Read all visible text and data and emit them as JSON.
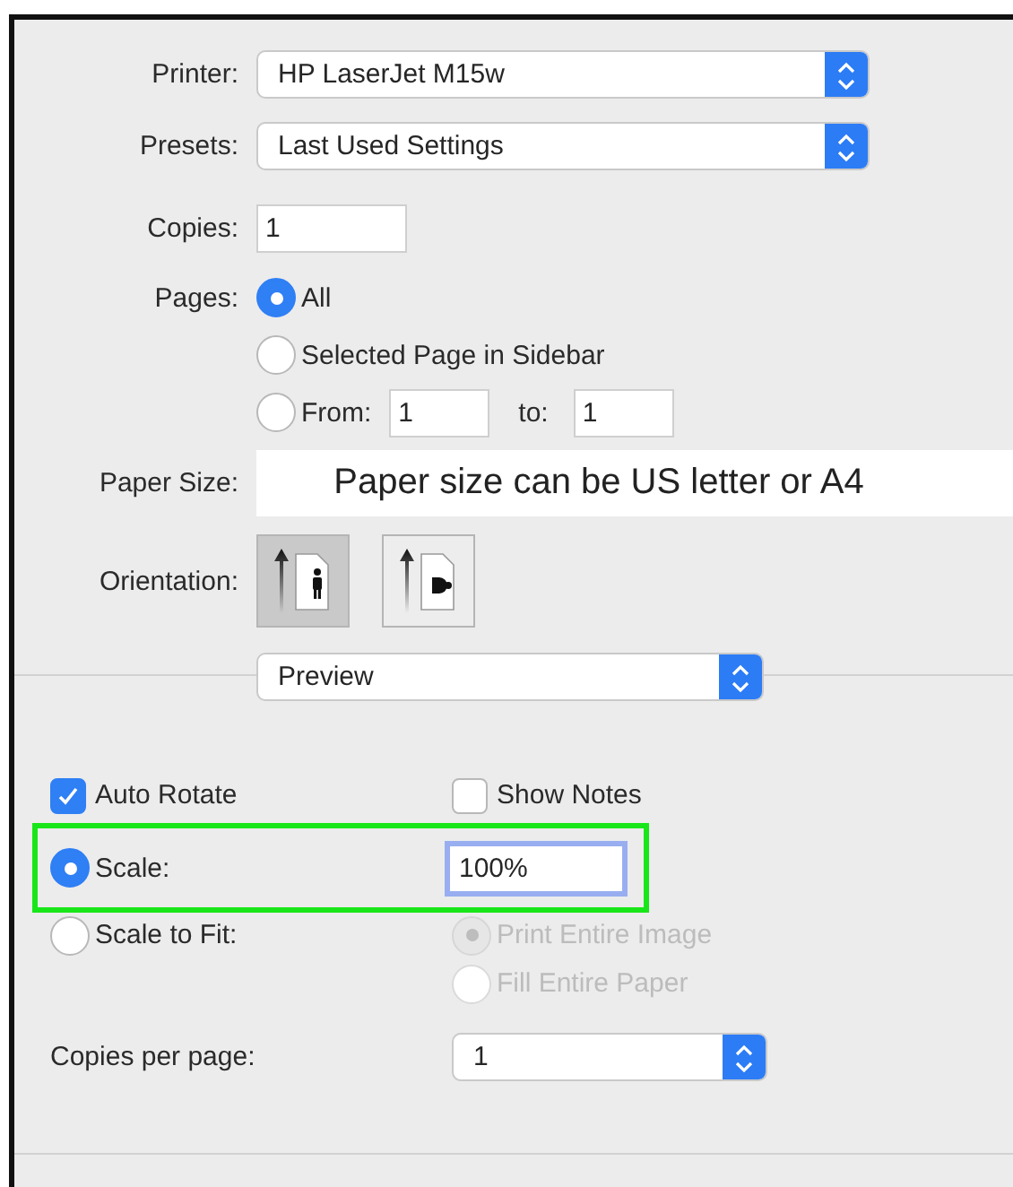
{
  "printer": {
    "label": "Printer:",
    "value": "HP LaserJet M15w"
  },
  "presets": {
    "label": "Presets:",
    "value": "Last Used Settings"
  },
  "copies": {
    "label": "Copies:",
    "value": "1"
  },
  "pages": {
    "label": "Pages:",
    "options": [
      {
        "kind": "plain",
        "label": "All",
        "selected": true
      },
      {
        "kind": "plain",
        "label": "Selected Page in Sidebar",
        "selected": false
      },
      {
        "kind": "range",
        "label": "From:",
        "selected": false,
        "from": "1",
        "to_label": "to:",
        "to": "1"
      }
    ]
  },
  "paper_size": {
    "label": "Paper Size:",
    "value": "Paper size can be US letter or A4"
  },
  "orientation": {
    "label": "Orientation:",
    "options": [
      {
        "kind": "portrait",
        "selected": true
      },
      {
        "kind": "landscape",
        "selected": false
      }
    ]
  },
  "section_menu": {
    "value": "Preview"
  },
  "auto_rotate": {
    "label": "Auto Rotate",
    "checked": true
  },
  "show_notes": {
    "label": "Show Notes",
    "checked": false
  },
  "scale": {
    "label": "Scale:",
    "selected": true,
    "value": "100%",
    "highlighted": true
  },
  "scale_to_fit": {
    "label": "Scale to Fit:",
    "selected": false,
    "options": [
      {
        "label": "Print Entire Image",
        "selected": true,
        "disabled": true
      },
      {
        "label": "Fill Entire Paper",
        "selected": false,
        "disabled": true
      }
    ]
  },
  "copies_per_page": {
    "label": "Copies per page:",
    "value": "1"
  }
}
